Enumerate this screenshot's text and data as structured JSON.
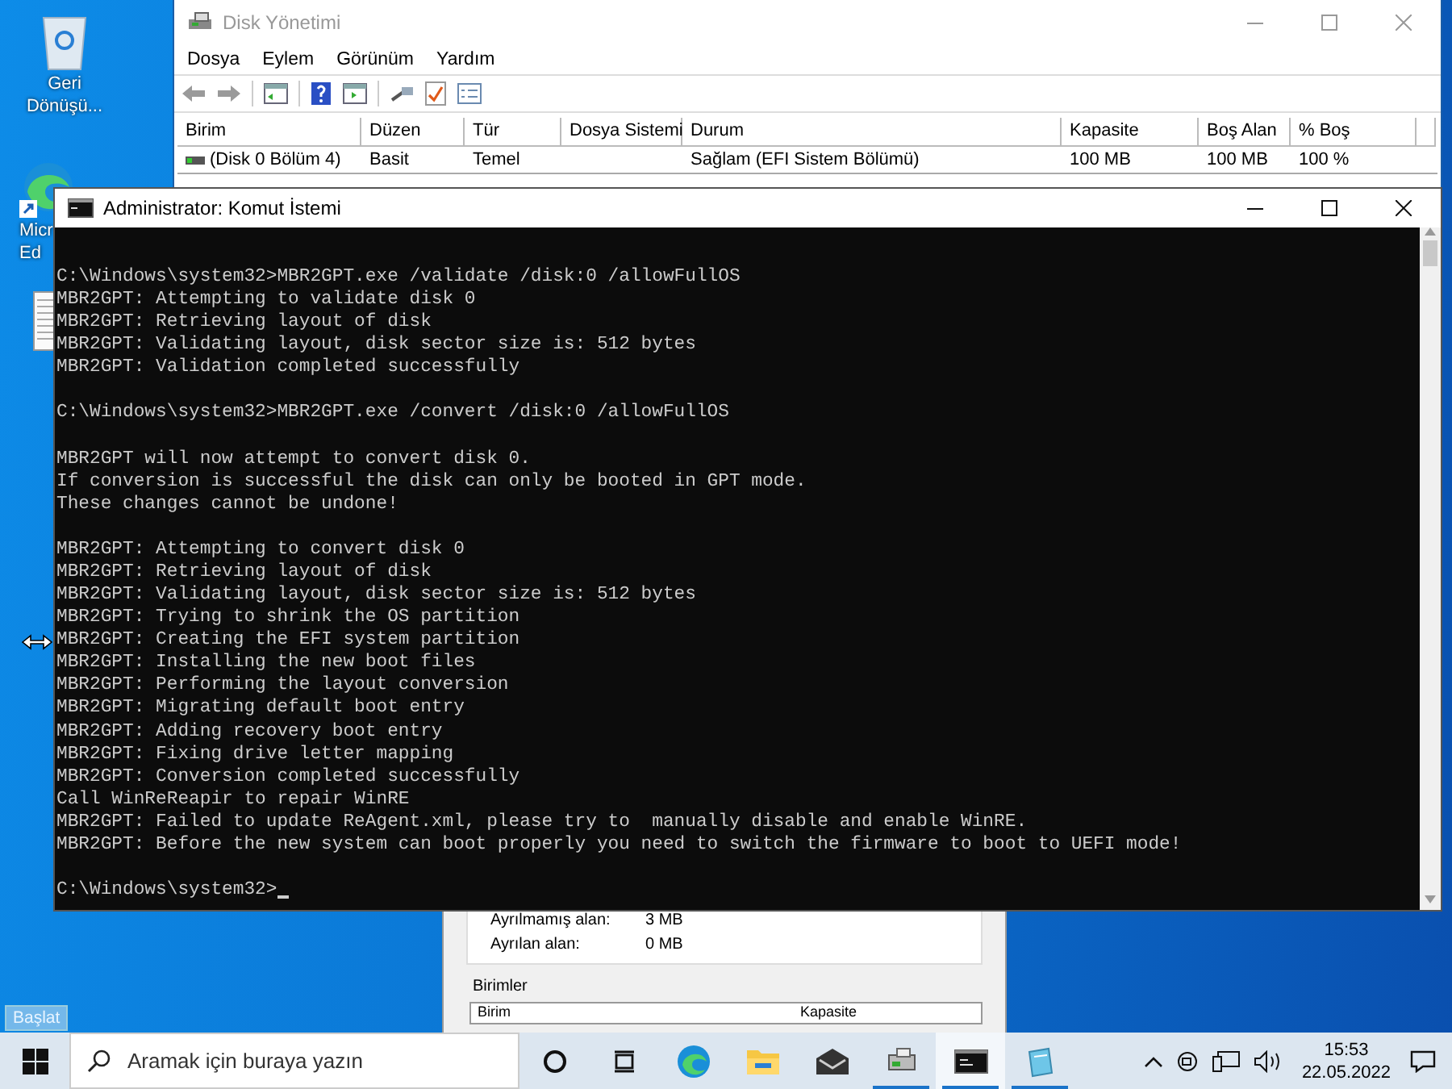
{
  "desktop_icons": [
    {
      "kind": "recycle",
      "lines": [
        "Geri",
        "Dönüşü..."
      ]
    },
    {
      "kind": "browser",
      "lines": [
        "Micr",
        "Ed"
      ]
    },
    {
      "kind": "file"
    }
  ],
  "start_tooltip": "Başlat",
  "disk_window": {
    "title": "Disk Yönetimi",
    "menu": [
      "Dosya",
      "Eylem",
      "Görünüm",
      "Yardım"
    ],
    "columns": [
      "Birim",
      "Düzen",
      "Tür",
      "Dosya Sistemi",
      "Durum",
      "Kapasite",
      "Boş Alan",
      "% Boş"
    ],
    "rows": [
      {
        "cells": [
          "(Disk 0 Bölüm 4)",
          "Basit",
          "Temel",
          "",
          "Sağlam (EFI Sistem Bölümü)",
          "100 MB",
          "100 MB",
          "100 %"
        ]
      }
    ]
  },
  "dialog": {
    "fields": [
      {
        "label": "Ayrılmamış alan:",
        "value": "3 MB"
      },
      {
        "label": "Ayrılan alan:",
        "value": "0 MB"
      }
    ],
    "section": "Birimler",
    "columns": [
      "Birim",
      "Kapasite"
    ]
  },
  "cmd_window": {
    "title": "Administrator: Komut İstemi",
    "blocks": [
      [
        "C:\\Windows\\system32>MBR2GPT.exe /validate /disk:0 /allowFullOS",
        "MBR2GPT: Attempting to validate disk 0",
        "MBR2GPT: Retrieving layout of disk",
        "MBR2GPT: Validating layout, disk sector size is: 512 bytes",
        "MBR2GPT: Validation completed successfully"
      ],
      [
        "C:\\Windows\\system32>MBR2GPT.exe /convert /disk:0 /allowFullOS"
      ],
      [
        "MBR2GPT will now attempt to convert disk 0.",
        "If conversion is successful the disk can only be booted in GPT mode.",
        "These changes cannot be undone!"
      ],
      [
        "MBR2GPT: Attempting to convert disk 0",
        "MBR2GPT: Retrieving layout of disk",
        "MBR2GPT: Validating layout, disk sector size is: 512 bytes",
        "MBR2GPT: Trying to shrink the OS partition",
        "MBR2GPT: Creating the EFI system partition",
        "MBR2GPT: Installing the new boot files",
        "MBR2GPT: Performing the layout conversion",
        "MBR2GPT: Migrating default boot entry",
        "MBR2GPT: Adding recovery boot entry",
        "MBR2GPT: Fixing drive letter mapping",
        "MBR2GPT: Conversion completed successfully",
        "Call WinReReapir to repair WinRE",
        "MBR2GPT: Failed to update ReAgent.xml, please try to  manually disable and enable WinRE.",
        "MBR2GPT: Before the new system can boot properly you need to switch the firmware to boot to UEFI mode!"
      ],
      [
        "C:\\Windows\\system32>"
      ]
    ]
  },
  "taskbar": {
    "search": {
      "placeholder": "Aramak için buraya yazın"
    },
    "apps": [
      {
        "kind": "cortana",
        "running": false,
        "active": false
      },
      {
        "kind": "taskview",
        "running": false,
        "active": false
      },
      {
        "kind": "edge",
        "running": false,
        "active": false
      },
      {
        "kind": "explorer",
        "running": false,
        "active": false
      },
      {
        "kind": "mail",
        "running": false,
        "active": false
      },
      {
        "kind": "diskmgmt",
        "running": true,
        "active": false
      },
      {
        "kind": "cmd",
        "running": true,
        "active": true
      },
      {
        "kind": "notepad",
        "running": true,
        "active": false
      }
    ],
    "time": "15:53",
    "date": "22.05.2022"
  }
}
